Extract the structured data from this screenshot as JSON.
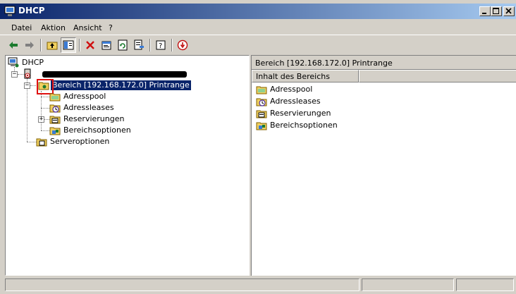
{
  "window": {
    "title": "DHCP"
  },
  "menu": [
    {
      "label": "Datei"
    },
    {
      "label": "Aktion"
    },
    {
      "label": "Ansicht"
    },
    {
      "label": "?"
    }
  ],
  "toolbar": {
    "buttons": [
      "back-icon",
      "forward-icon",
      "up-folder-icon",
      "show-tree-icon",
      "delete-icon",
      "properties-icon",
      "refresh-icon",
      "export-icon",
      "help-icon",
      "stop-icon"
    ]
  },
  "tree": {
    "root": "DHCP",
    "server": "",
    "scope": "Bereich [192.168.172.0] Printrange",
    "scope_children": [
      "Adresspool",
      "Adressleases",
      "Reservierungen",
      "Bereichsoptionen"
    ],
    "server_options": "Serveroptionen"
  },
  "right_pane": {
    "header": "Bereich [192.168.172.0] Printrange",
    "column": "Inhalt des Bereichs",
    "items": [
      "Adresspool",
      "Adressleases",
      "Reservierungen",
      "Bereichsoptionen"
    ]
  },
  "colors": {
    "title_start": "#0a246a",
    "title_end": "#a6caf0",
    "selection": "#0a246a",
    "highlight": "#e01010",
    "face": "#d4d0c8"
  }
}
